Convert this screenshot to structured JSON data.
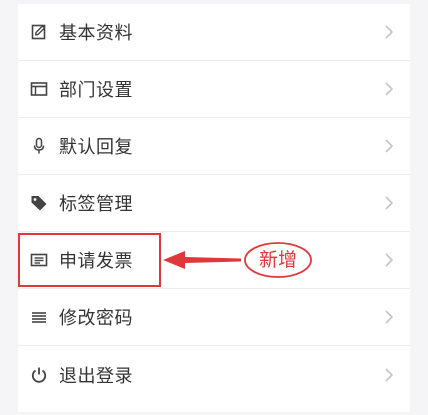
{
  "menu": {
    "items": [
      {
        "label": "基本资料",
        "icon": "edit-icon"
      },
      {
        "label": "部门设置",
        "icon": "window-icon"
      },
      {
        "label": "默认回复",
        "icon": "microphone-icon"
      },
      {
        "label": "标签管理",
        "icon": "tag-icon"
      },
      {
        "label": "申请发票",
        "icon": "invoice-icon"
      },
      {
        "label": "修改密码",
        "icon": "lines-icon"
      },
      {
        "label": "退出登录",
        "icon": "power-icon"
      }
    ]
  },
  "annotation": {
    "badge_text": "新增",
    "highlight_color": "#e0383a"
  }
}
